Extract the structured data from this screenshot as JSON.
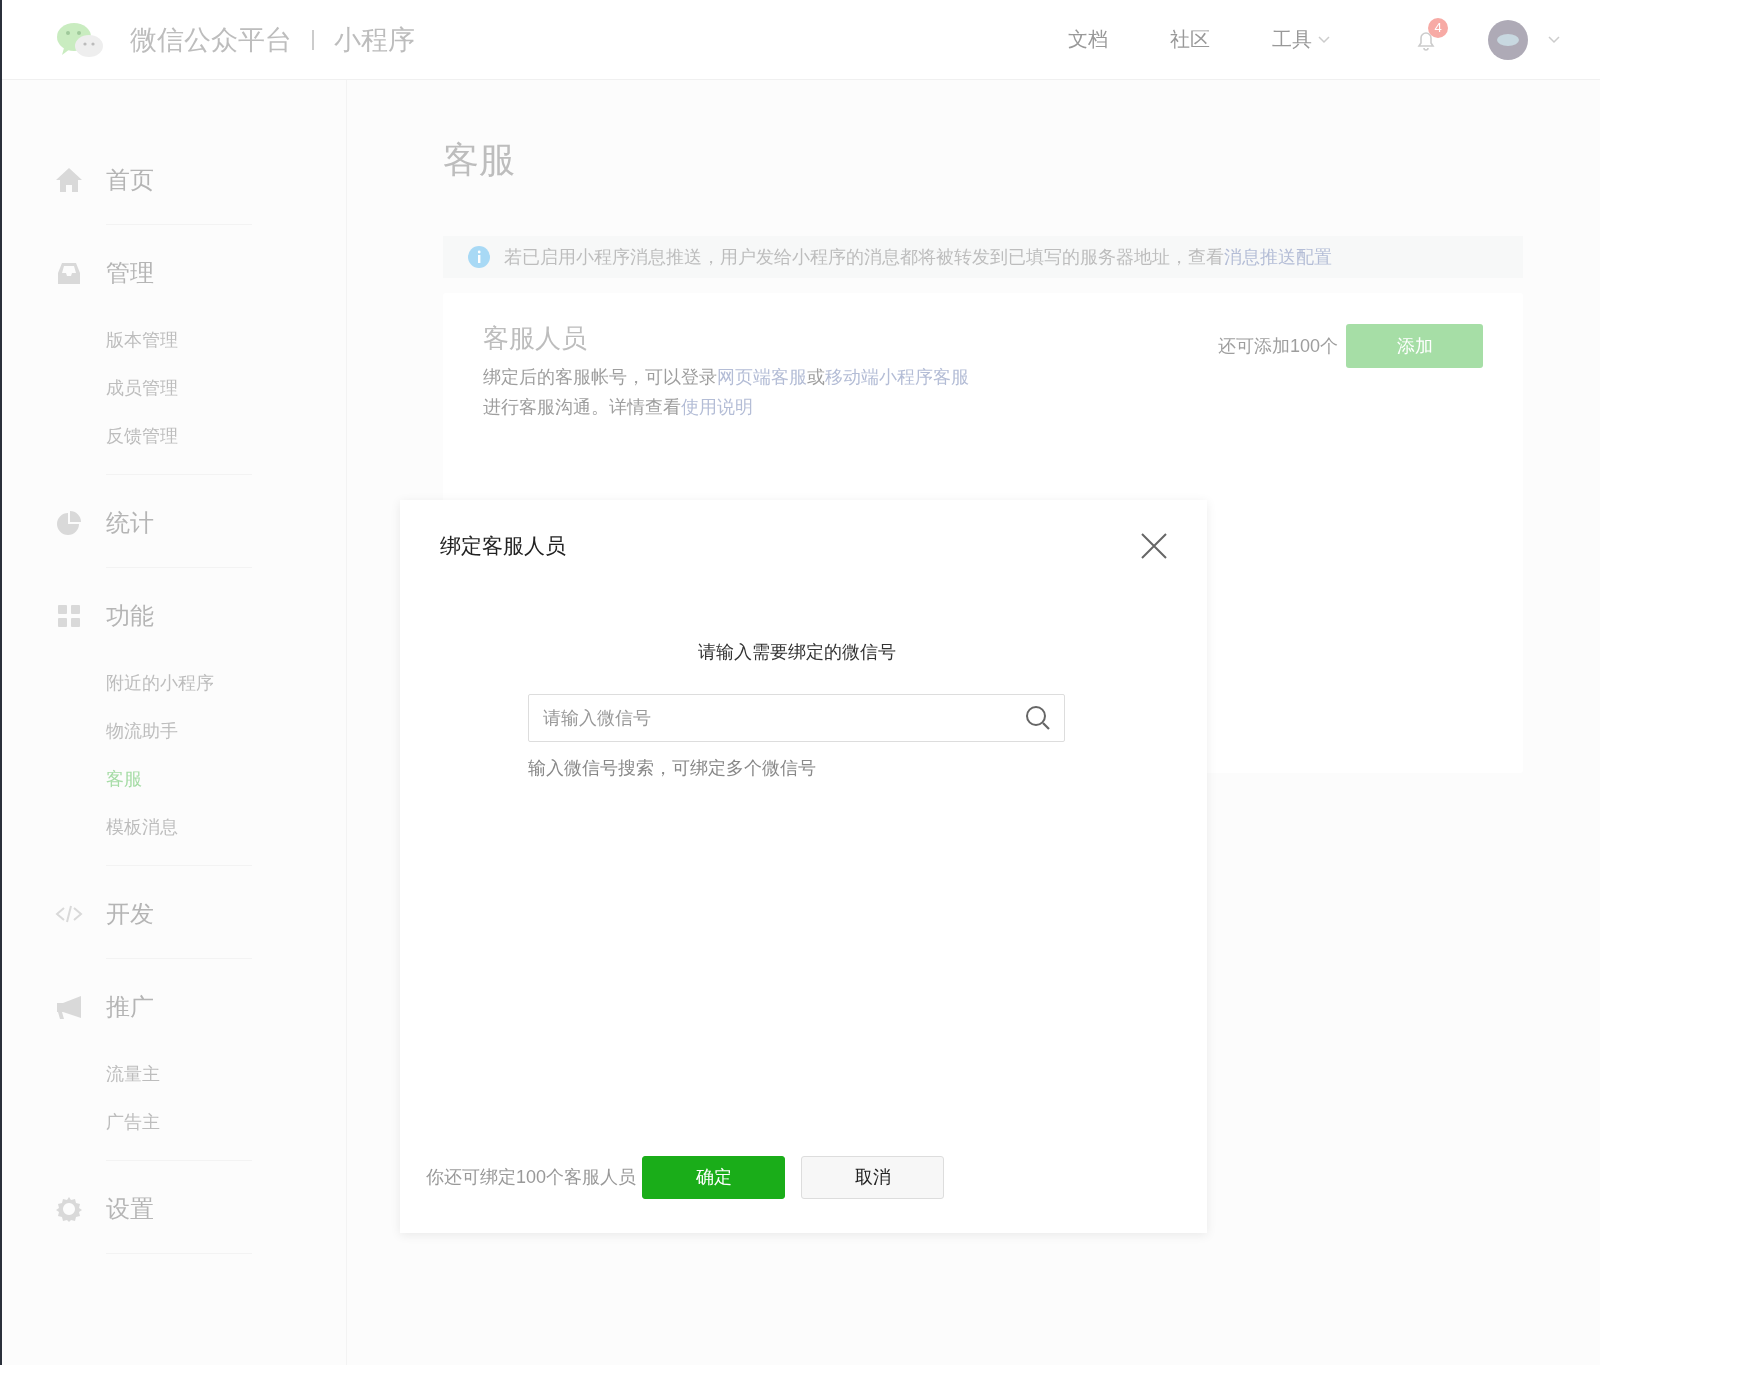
{
  "header": {
    "brand": "微信公众平台",
    "product": "小程序",
    "nav": [
      {
        "label": "文档",
        "dropdown": false
      },
      {
        "label": "社区",
        "dropdown": false
      },
      {
        "label": "工具",
        "dropdown": true
      }
    ],
    "notification_badge": "4"
  },
  "sidebar": {
    "groups": [
      {
        "label": "首页"
      },
      {
        "label": "管理",
        "children": [
          {
            "label": "版本管理",
            "selected": false
          },
          {
            "label": "成员管理",
            "selected": false
          },
          {
            "label": "反馈管理",
            "selected": false
          }
        ]
      },
      {
        "label": "统计"
      },
      {
        "label": "功能",
        "children": [
          {
            "label": "附近的小程序",
            "selected": false
          },
          {
            "label": "物流助手",
            "selected": false
          },
          {
            "label": "客服",
            "selected": true
          },
          {
            "label": "模板消息",
            "selected": false
          }
        ]
      },
      {
        "label": "开发"
      },
      {
        "label": "推广",
        "children": [
          {
            "label": "流量主",
            "selected": false
          },
          {
            "label": "广告主",
            "selected": false
          }
        ]
      },
      {
        "label": "设置"
      }
    ]
  },
  "page": {
    "title": "客服",
    "notice": [
      {
        "text": "若已启用小程序消息推送，用户发给小程序的消息都将被转发到已填写的服务器地址，查看",
        "kind": "text"
      },
      {
        "text": "消息推送配置",
        "kind": "link"
      }
    ],
    "card": {
      "title": "客服人员",
      "description": [
        [
          {
            "text": "绑定后的客服帐号，可以登录",
            "kind": "text"
          },
          {
            "text": "网页端客服",
            "kind": "link"
          },
          {
            "text": "或",
            "kind": "text"
          },
          {
            "text": "移动端小程序客服",
            "kind": "link"
          }
        ],
        [
          {
            "text": "进行客服沟通。详情查看",
            "kind": "text"
          },
          {
            "text": "使用说明",
            "kind": "link"
          }
        ]
      ],
      "quota": "还可添加100个",
      "add_button": "添加"
    }
  },
  "dialog": {
    "title": "绑定客服人员",
    "prompt": "请输入需要绑定的微信号",
    "search": {
      "placeholder": "请输入微信号"
    },
    "hint": "输入微信号搜索，可绑定多个微信号",
    "quota": "你还可绑定100个客服人员",
    "buttons": [
      {
        "label": "确定",
        "kind": "primary"
      },
      {
        "label": "取消",
        "kind": "default"
      }
    ]
  }
}
